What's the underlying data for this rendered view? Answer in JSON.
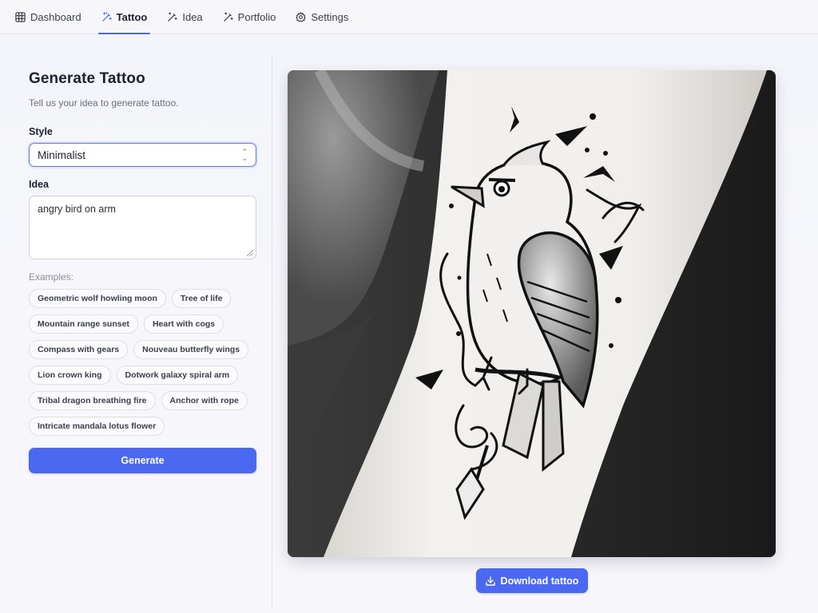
{
  "nav": {
    "items": [
      {
        "label": "Dashboard",
        "icon": "grid-icon"
      },
      {
        "label": "Tattoo",
        "icon": "magic-wand-icon",
        "active": true
      },
      {
        "label": "Idea",
        "icon": "magic-wand-icon"
      },
      {
        "label": "Portfolio",
        "icon": "magic-wand-icon"
      },
      {
        "label": "Settings",
        "icon": "gear-icon"
      }
    ],
    "accent": "#4a68f0"
  },
  "form": {
    "title": "Generate Tattoo",
    "subtitle": "Tell us your idea to generate tattoo.",
    "style_label": "Style",
    "style_value": "Minimalist",
    "idea_label": "Idea",
    "idea_value": "angry bird on arm",
    "examples_label": "Examples:",
    "examples": [
      "Geometric wolf howling moon",
      "Tree of life",
      "Mountain range sunset",
      "Heart with cogs",
      "Compass with gears",
      "Nouveau butterfly wings",
      "Lion crown king",
      "Dotwork galaxy spiral arm",
      "Tribal dragon breathing fire",
      "Anchor with rope",
      "Intricate mandala lotus flower"
    ],
    "generate_label": "Generate"
  },
  "result": {
    "image_description_icon": "tattoo-image",
    "download_label": "Download tattoo",
    "download_icon": "download-icon"
  },
  "colors": {
    "primary": "#4a68f0",
    "background": "#f5f6fa"
  }
}
